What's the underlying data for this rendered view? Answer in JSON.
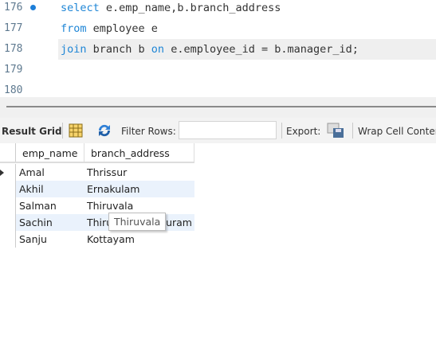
{
  "editor": {
    "lines": [
      {
        "num": "176",
        "parts": [
          {
            "t": "select",
            "kw": true
          },
          {
            "t": " e.emp_name,b.branch_address"
          }
        ],
        "marker": true
      },
      {
        "num": "177",
        "parts": [
          {
            "t": "from",
            "kw": true
          },
          {
            "t": " employee e"
          }
        ]
      },
      {
        "num": "178",
        "parts": [
          {
            "t": "join",
            "kw": true
          },
          {
            "t": " branch b "
          },
          {
            "t": "on",
            "kw": true
          },
          {
            "t": " e.employee_id = b.manager_id;"
          }
        ],
        "highlight": true
      },
      {
        "num": "179",
        "parts": []
      },
      {
        "num": "180",
        "parts": []
      }
    ]
  },
  "toolbar": {
    "result_grid": "Result Grid",
    "filter_rows": "Filter Rows:",
    "filter_value": "",
    "export": "Export:",
    "wrap": "Wrap Cell Content"
  },
  "grid": {
    "columns": [
      "emp_name",
      "branch_address"
    ],
    "rows": [
      [
        "Amal",
        "Thrissur"
      ],
      [
        "Akhil",
        "Ernakulam"
      ],
      [
        "Salman",
        "Thiruvala"
      ],
      [
        "Sachin",
        "Thiruvananthapuram"
      ],
      [
        "Sanju",
        "Kottayam"
      ]
    ]
  },
  "tooltip": "Thiruvala",
  "colors": {
    "keyword": "#1f86d6",
    "row_alt": "#eaf2fc"
  }
}
